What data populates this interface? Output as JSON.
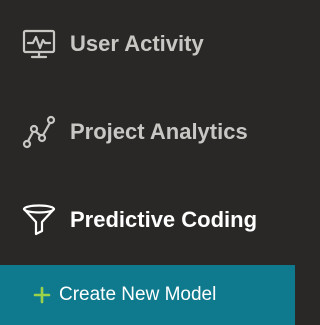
{
  "nav": {
    "items": [
      {
        "label": "User Activity",
        "icon": "monitor-activity-icon",
        "active": false
      },
      {
        "label": "Project Analytics",
        "icon": "graph-nodes-icon",
        "active": false
      },
      {
        "label": "Predictive Coding",
        "icon": "funnel-icon",
        "active": true
      }
    ]
  },
  "create": {
    "label": "Create New Model",
    "icon": "plus-icon"
  },
  "colors": {
    "background": "#2a2826",
    "text": "#c9c7c4",
    "active_text": "#ffffff",
    "create_bar": "#0f7a8e",
    "plus": "#9bd24a"
  }
}
